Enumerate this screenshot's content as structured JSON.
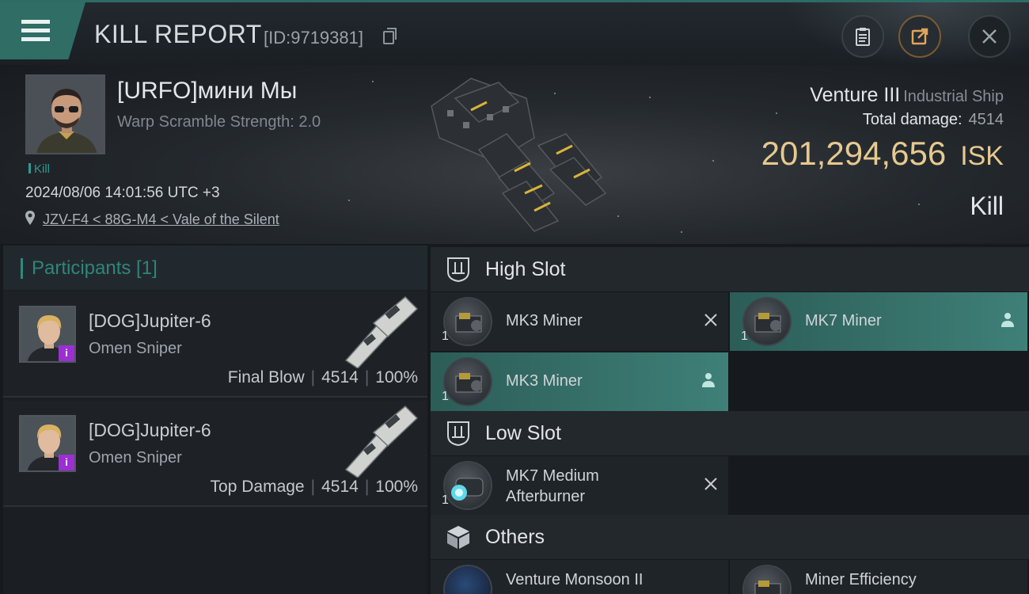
{
  "window": {
    "title": "KILL REPORT",
    "report_id": "[ID:9719381]"
  },
  "victim": {
    "name": "[URFO]мини Мы",
    "warp_scramble": "Warp Scramble Strength: 2.0",
    "kill_tag": "Kill",
    "datetime": "2024/08/06 14:01:56 UTC +3",
    "location": "JZV-F4 < 88G-M4 < Vale of the Silent"
  },
  "ship": {
    "name": "Venture III",
    "class": "Industrial Ship",
    "total_damage_label": "Total damage:",
    "total_damage": "4514",
    "isk_value": "201,294,656",
    "isk_unit": "ISK",
    "outcome": "Kill"
  },
  "participants": {
    "label": "Participants [1]",
    "rows": [
      {
        "name": "[DOG]Jupiter-6",
        "ship": "Omen Sniper",
        "role": "Final Blow",
        "damage": "4514",
        "percent": "100%",
        "badge": "i"
      },
      {
        "name": "[DOG]Jupiter-6",
        "ship": "Omen Sniper",
        "role": "Top Damage",
        "damage": "4514",
        "percent": "100%",
        "badge": "i"
      }
    ]
  },
  "slots": {
    "high": {
      "label": "High Slot",
      "modules": [
        {
          "name": "MK3 Miner",
          "qty": "1",
          "state": "destroyed"
        },
        {
          "name": "MK7 Miner",
          "qty": "1",
          "state": "dropped"
        },
        {
          "name": "MK3 Miner",
          "qty": "1",
          "state": "dropped"
        }
      ]
    },
    "low": {
      "label": "Low Slot",
      "modules": [
        {
          "name_line1": "MK7 Medium",
          "name_line2": "Afterburner",
          "qty": "1",
          "state": "destroyed"
        }
      ]
    },
    "others": {
      "label": "Others",
      "modules": [
        {
          "name": "Venture Monsoon II",
          "state": "destroyed"
        },
        {
          "name": "Miner Efficiency",
          "state": "destroyed"
        }
      ]
    }
  },
  "colors": {
    "accent": "#2f6d65",
    "highlight": "#3e8078",
    "isk": "#e7c98f",
    "badge": "#9b2fd4"
  },
  "icons": [
    "menu-icon",
    "copy-icon",
    "clipboard-icon",
    "share-icon",
    "close-icon",
    "location-pin-icon",
    "slot-icon",
    "cube-icon",
    "x-icon",
    "person-icon"
  ]
}
